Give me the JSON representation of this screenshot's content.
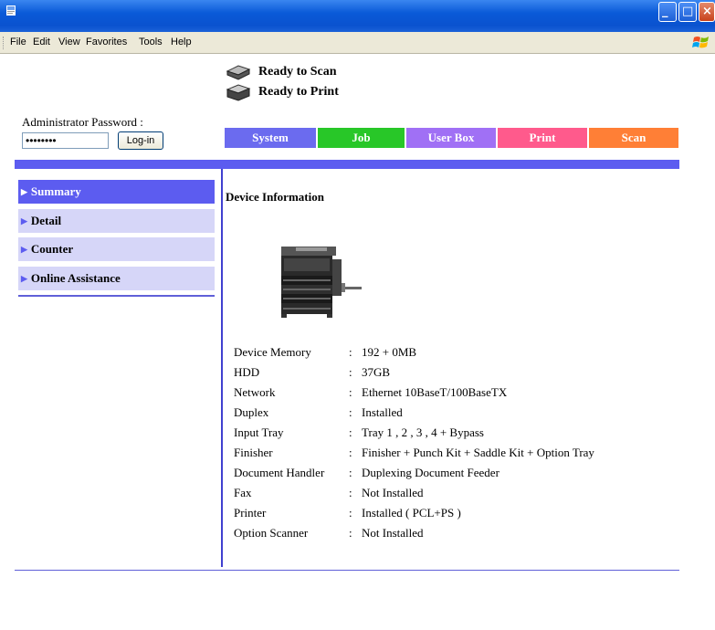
{
  "menubar": [
    "File",
    "Edit",
    "View",
    "Favorites",
    "Tools",
    "Help"
  ],
  "status": {
    "scan": "Ready to Scan",
    "print": "Ready to Print"
  },
  "login": {
    "label": "Administrator Password :",
    "password_value": "••••••••",
    "button": "Log-in"
  },
  "tabs": [
    {
      "label": "System",
      "color": "#6b6bef"
    },
    {
      "label": "Job",
      "color": "#28c728"
    },
    {
      "label": "User Box",
      "color": "#a070f5"
    },
    {
      "label": "Print",
      "color": "#ff5a8c"
    },
    {
      "label": "Scan",
      "color": "#ff7f36"
    }
  ],
  "nav": [
    "Summary",
    "Detail",
    "Counter",
    "Online Assistance"
  ],
  "section_title": "Device Information",
  "device_info": [
    {
      "label": "Device Memory",
      "value": "192 + 0MB"
    },
    {
      "label": "HDD",
      "value": "37GB"
    },
    {
      "label": "Network",
      "value": "Ethernet 10BaseT/100BaseTX"
    },
    {
      "label": "Duplex",
      "value": "Installed"
    },
    {
      "label": "Input Tray",
      "value": "Tray 1 , 2 , 3 , 4 + Bypass"
    },
    {
      "label": "Finisher",
      "value": "Finisher + Punch Kit + Saddle Kit + Option Tray"
    },
    {
      "label": "Document Handler",
      "value": "Duplexing Document Feeder"
    },
    {
      "label": "Fax",
      "value": "Not Installed"
    },
    {
      "label": "Printer",
      "value": "Installed ( PCL+PS )"
    },
    {
      "label": "Option Scanner",
      "value": "Not Installed"
    }
  ],
  "colors": {
    "nav_active": "#5c5cf0",
    "nav_inactive": "#d6d6f8",
    "divider": "#5c5cf0"
  }
}
